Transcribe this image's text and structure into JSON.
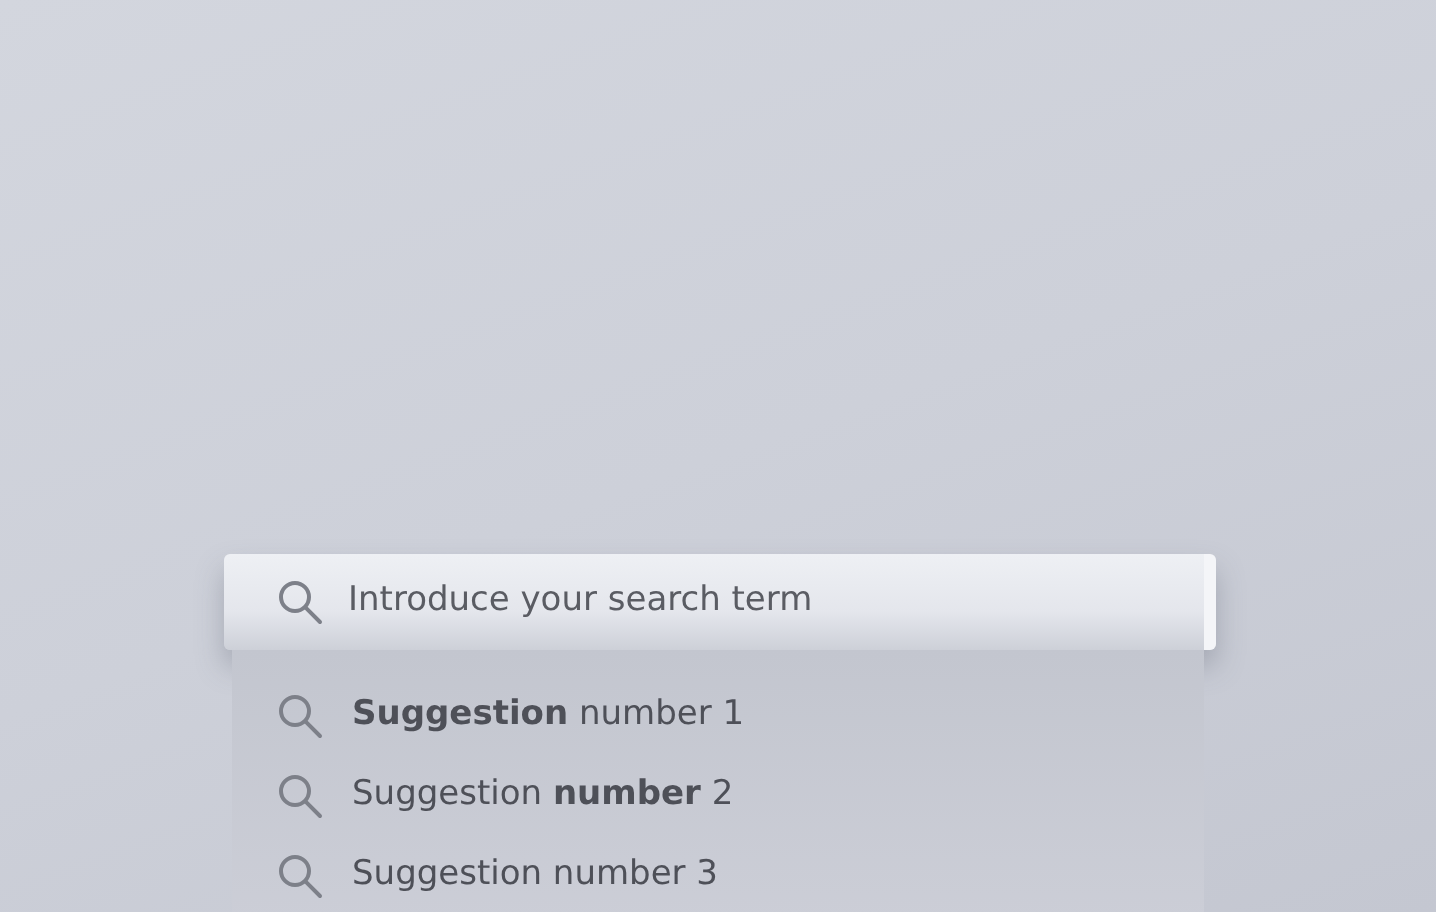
{
  "search": {
    "placeholder": "Introduce your search term"
  },
  "suggestions": [
    {
      "text": "**Suggestion** number 1"
    },
    {
      "text": "Suggestion **number** 2"
    },
    {
      "text": "Suggestion number 3"
    }
  ]
}
